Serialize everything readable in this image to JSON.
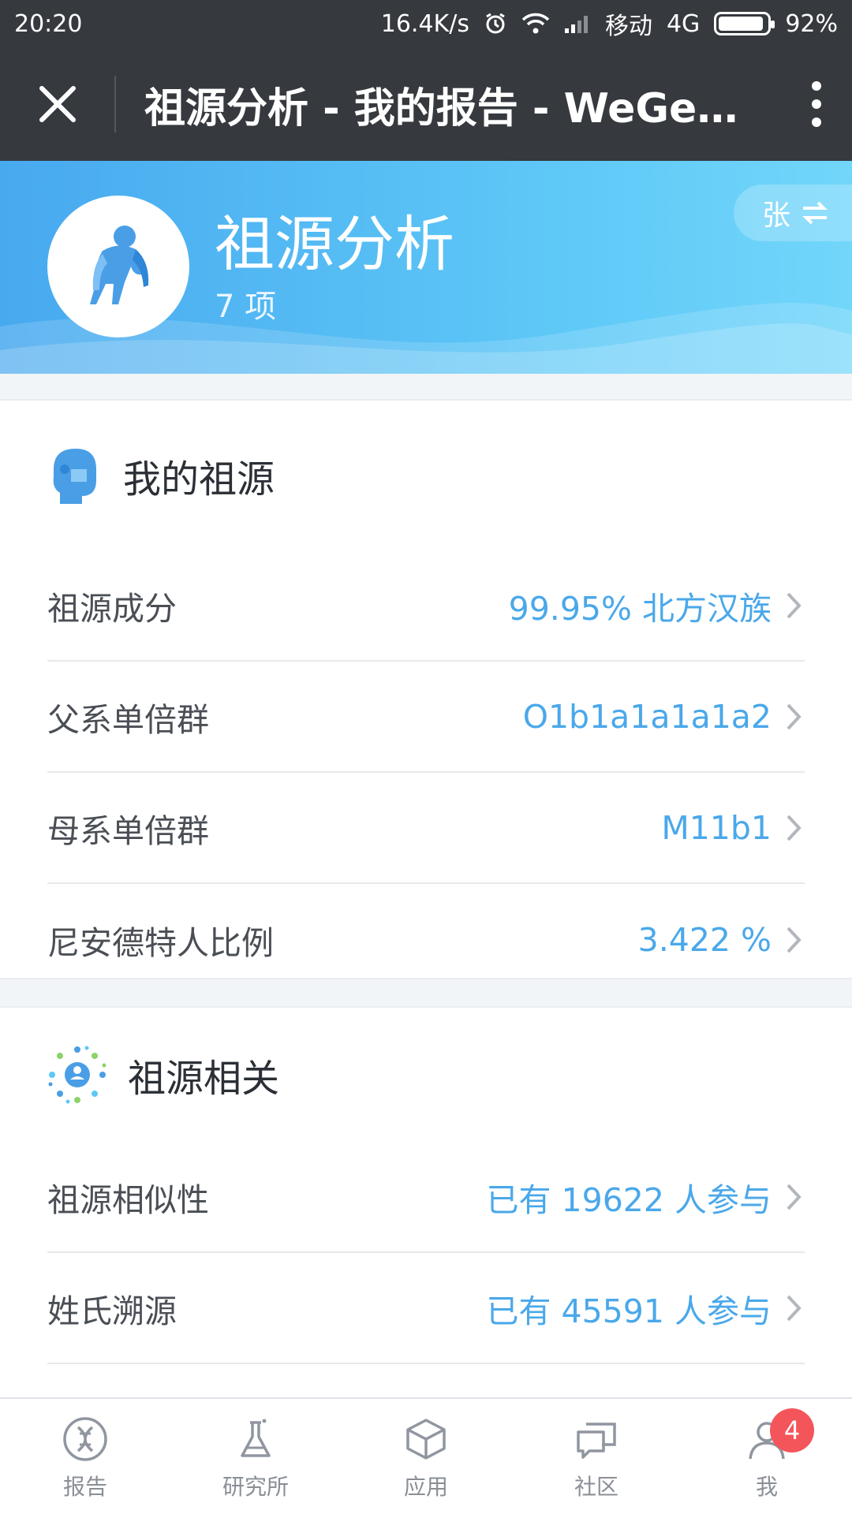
{
  "status_bar": {
    "time": "20:20",
    "speed": "16.4K/s",
    "carrier": "移动",
    "network": "4G",
    "battery": "92%",
    "battery_level": 0.92
  },
  "title_bar": {
    "title": "祖源分析 - 我的报告 - WeGen...",
    "close_icon": "close-icon",
    "more_icon": "more-vertical-icon"
  },
  "hero": {
    "title": "祖源分析",
    "count": "7 项",
    "switch_label": "张",
    "avatar_icon": "ape-icon",
    "colors": {
      "start": "#48a9ef",
      "end": "#72d6fa"
    }
  },
  "my_ancestry": {
    "title": "我的祖源",
    "icon": "profile-head-icon",
    "rows": [
      {
        "label": "祖源成分",
        "value": "99.95% 北方汉族"
      },
      {
        "label": "父系单倍群",
        "value": "O1b1a1a1a1a2"
      },
      {
        "label": "母系单倍群",
        "value": "M11b1"
      },
      {
        "label": "尼安德特人比例",
        "value": "3.422 %"
      }
    ]
  },
  "ancestry_related": {
    "title": "祖源相关",
    "icon": "network-people-icon",
    "rows": [
      {
        "label": "祖源相似性",
        "value": "已有 19622 人参与"
      },
      {
        "label": "姓氏溯源",
        "value": "已有 45591 人参与"
      }
    ]
  },
  "bottom_nav": {
    "items": [
      {
        "label": "报告",
        "icon": "dna-icon"
      },
      {
        "label": "研究所",
        "icon": "flask-icon"
      },
      {
        "label": "应用",
        "icon": "cube-icon"
      },
      {
        "label": "社区",
        "icon": "chat-icon"
      },
      {
        "label": "我",
        "icon": "user-icon",
        "badge": "4"
      }
    ]
  },
  "colors": {
    "accent": "#4aa8ea",
    "badge": "#f4555a",
    "titlebar": "#36393e"
  }
}
